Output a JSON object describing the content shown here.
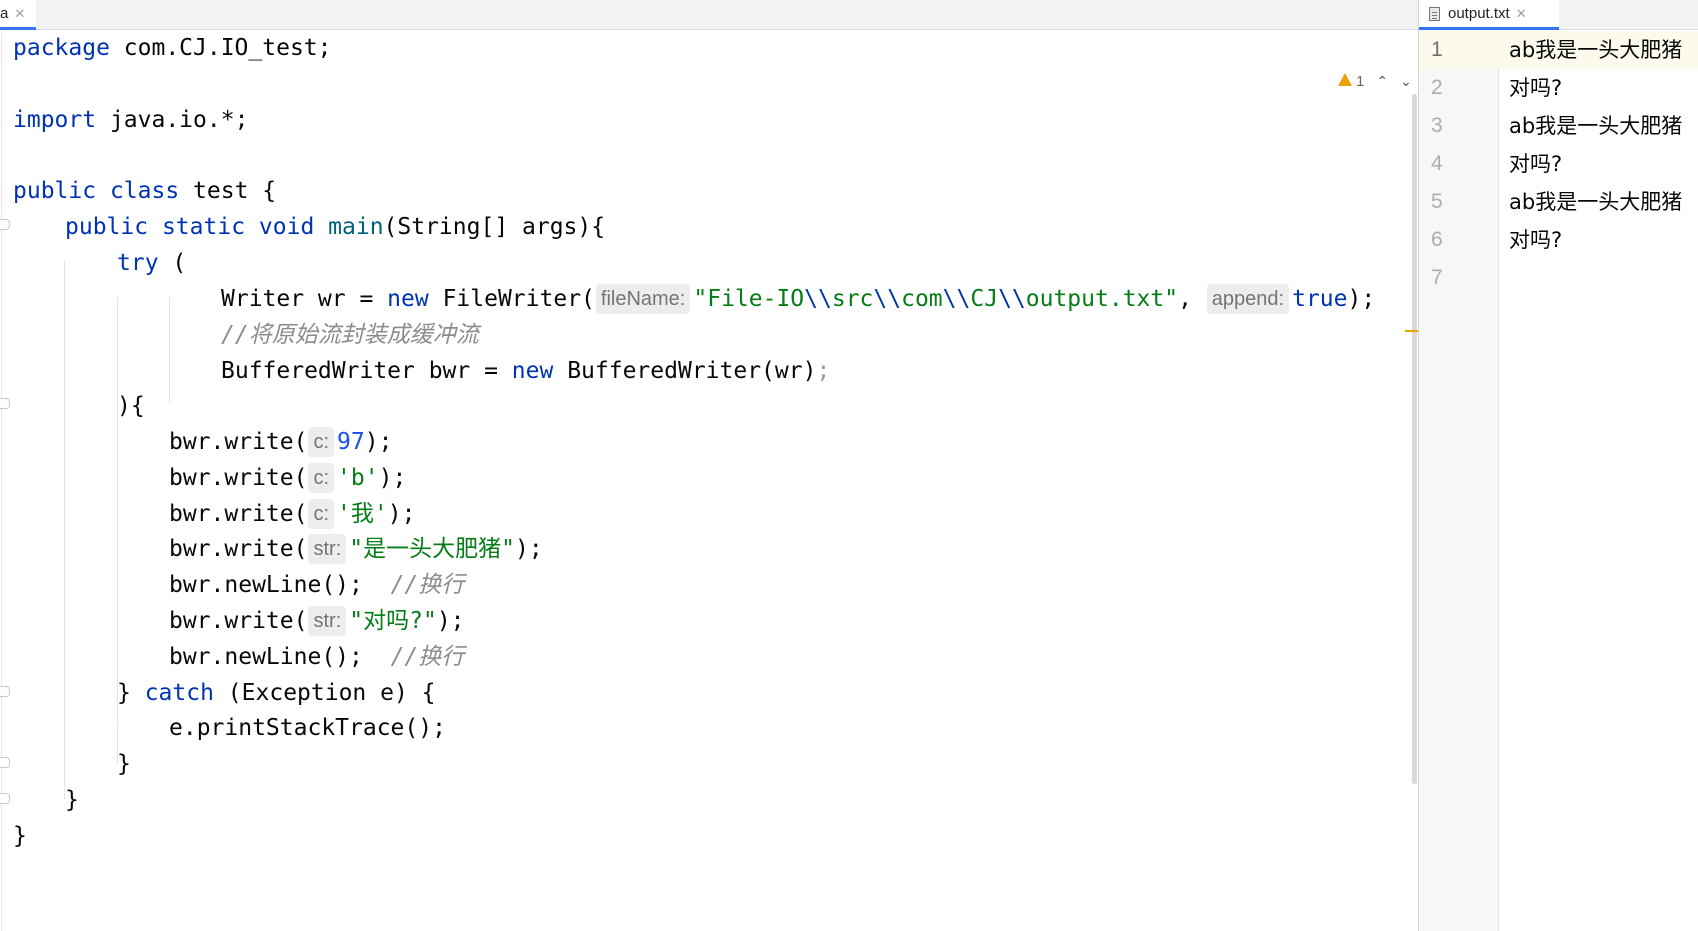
{
  "tabs_left": {
    "active_tab_fragment": "a"
  },
  "tabs_right": {
    "active_tab": "output.txt"
  },
  "inspection": {
    "warning_count": "1"
  },
  "code": {
    "l1_kw": "package",
    "l1_rest": " com.CJ.IO_test;",
    "l3_kw": "import",
    "l3_rest": " java.io.*;",
    "l5_kw1": "public",
    "l5_kw2": "class",
    "l5_rest": " test {",
    "l6_kw1": "public",
    "l6_kw2": "static",
    "l6_kw3": "void",
    "l6_fn": "main",
    "l6_rest": "(String[] args){",
    "l7_kw": "try",
    "l7_rest": " (",
    "l8_a": "Writer wr = ",
    "l8_new": "new",
    "l8_b": " FileWriter(",
    "l8_hint1": "fileName:",
    "l8_s1": "\"File-IO",
    "l8_e1": "\\\\",
    "l8_s2": "src",
    "l8_e2": "\\\\",
    "l8_s3": "com",
    "l8_e3": "\\\\",
    "l8_s4": "CJ",
    "l8_e4": "\\\\",
    "l8_s5": "output.txt\"",
    "l8_c": ", ",
    "l8_hint2": "append:",
    "l8_true": "true",
    "l8_end": ");",
    "l9_cmt": "//将原始流封装成缓冲流",
    "l10_a": "BufferedWriter bwr = ",
    "l10_new": "new",
    "l10_b": " BufferedWriter(wr)",
    "l10_semi": ";",
    "l11": "){",
    "l12_a": "bwr.write(",
    "l12_hint": "c:",
    "l12_num": "97",
    "l12_end": ");",
    "l13_a": "bwr.write(",
    "l13_hint": "c:",
    "l13_str": "'b'",
    "l13_end": ");",
    "l14_a": "bwr.write(",
    "l14_hint": "c:",
    "l14_str": "'我'",
    "l14_end": ");",
    "l15_a": "bwr.write(",
    "l15_hint": "str:",
    "l15_str": "\"是一头大肥猪\"",
    "l15_end": ");",
    "l16_a": "bwr.newLine();  ",
    "l16_cmt": "//换行",
    "l17_a": "bwr.write(",
    "l17_hint": "str:",
    "l17_str": "\"对吗?\"",
    "l17_end": ");",
    "l18_a": "bwr.newLine();  ",
    "l18_cmt": "//换行",
    "l19_a": "} ",
    "l19_kw": "catch",
    "l19_rest": " (Exception e) {",
    "l20": "e.printStackTrace();",
    "l21": "}",
    "l22": "}",
    "l23": "}"
  },
  "output_file": {
    "line_numbers": [
      "1",
      "2",
      "3",
      "4",
      "5",
      "6",
      "7"
    ],
    "lines": [
      "ab我是一头大肥猪",
      "对吗?",
      "ab我是一头大肥猪",
      "对吗?",
      "ab我是一头大肥猪",
      "对吗?",
      ""
    ]
  }
}
